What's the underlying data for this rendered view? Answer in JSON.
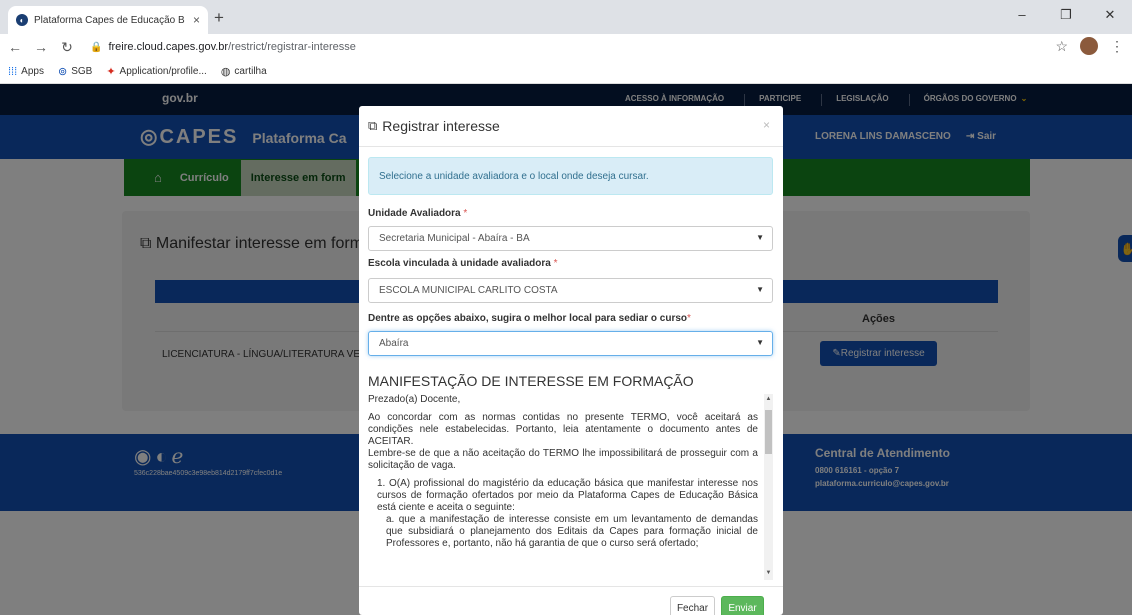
{
  "browser": {
    "tab_title": "Plataforma Capes de Educação B",
    "tab_close": "×",
    "new_tab": "+",
    "url_host": "freire.cloud.capes.gov.br",
    "url_path": "/restrict/registrar-interesse",
    "bookmarks": [
      {
        "label": "Apps",
        "icon": "apps-grid-icon"
      },
      {
        "label": "SGB",
        "icon": "capes-icon"
      },
      {
        "label": "Application/profile...",
        "icon": "maple-leaf-icon"
      },
      {
        "label": "cartilha",
        "icon": "globe-icon"
      }
    ]
  },
  "govbar": {
    "brand": "gov.br",
    "links": [
      "ACESSO À INFORMAÇÃO",
      "PARTICIPE",
      "LEGISLAÇÃO",
      "ÓRGÃOS DO GOVERNO"
    ]
  },
  "header": {
    "logo": "CAPES",
    "platform": "Plataforma Ca",
    "user": "LORENA LINS DAMASCENO",
    "logout": "Sair"
  },
  "menu": {
    "items": [
      "Currículo",
      "Interesse em form"
    ]
  },
  "panel": {
    "title": "Manifestar interesse em forma",
    "col_actions": "Ações",
    "row_course": "LICENCIATURA - LÍNGUA/LITERATURA VE",
    "row_button": "Registrar interesse"
  },
  "footer": {
    "hash": "536c228bae4509c3e98eb814d2179ff7cfec0d1e",
    "central": "Central de Atendimento",
    "phone": "0800 616161 - opção 7",
    "email": "plataforma.curriculo@capes.gov.br"
  },
  "modal": {
    "title": "Registrar interesse",
    "close": "×",
    "info": "Selecione a unidade avaliadora e o local onde deseja cursar.",
    "unidade_label": "Unidade Avaliadora",
    "unidade_value": "Secretaria Municipal - Abaíra - BA",
    "escola_label": "Escola vinculada à unidade avaliadora",
    "escola_value": "ESCOLA MUNICIPAL CARLITO COSTA",
    "local_label": "Dentre as opções abaixo, sugira o melhor local para sediar o curso",
    "local_value": "Abaíra",
    "required_mark": "*",
    "terms_title": "MANIFESTAÇÃO DE INTERESSE EM FORMAÇÃO",
    "terms": {
      "greeting": "Prezado(a) Docente,",
      "p1": "Ao concordar com as normas contidas no presente TERMO, você aceitará as condições nele estabelecidas. Portanto, leia atentamente o documento antes de ACEITAR.",
      "p2": "Lembre-se de que a não aceitação do TERMO lhe impossibilitará de prosseguir com a solicitação de vaga.",
      "item1": "1. O(A) profissional do magistério da educação básica que manifestar interesse nos cursos de formação ofertados por meio da Plataforma Capes de Educação Básica está ciente e aceita o seguinte:",
      "item1a": "a. que a manifestação de interesse consiste em um levantamento de demandas que subsidiará o planejamento dos Editais da Capes para formação inicial de Professores e, portanto, não há garantia de que o curso será ofertado;"
    },
    "btn_close": "Fechar",
    "btn_send": "Enviar"
  }
}
